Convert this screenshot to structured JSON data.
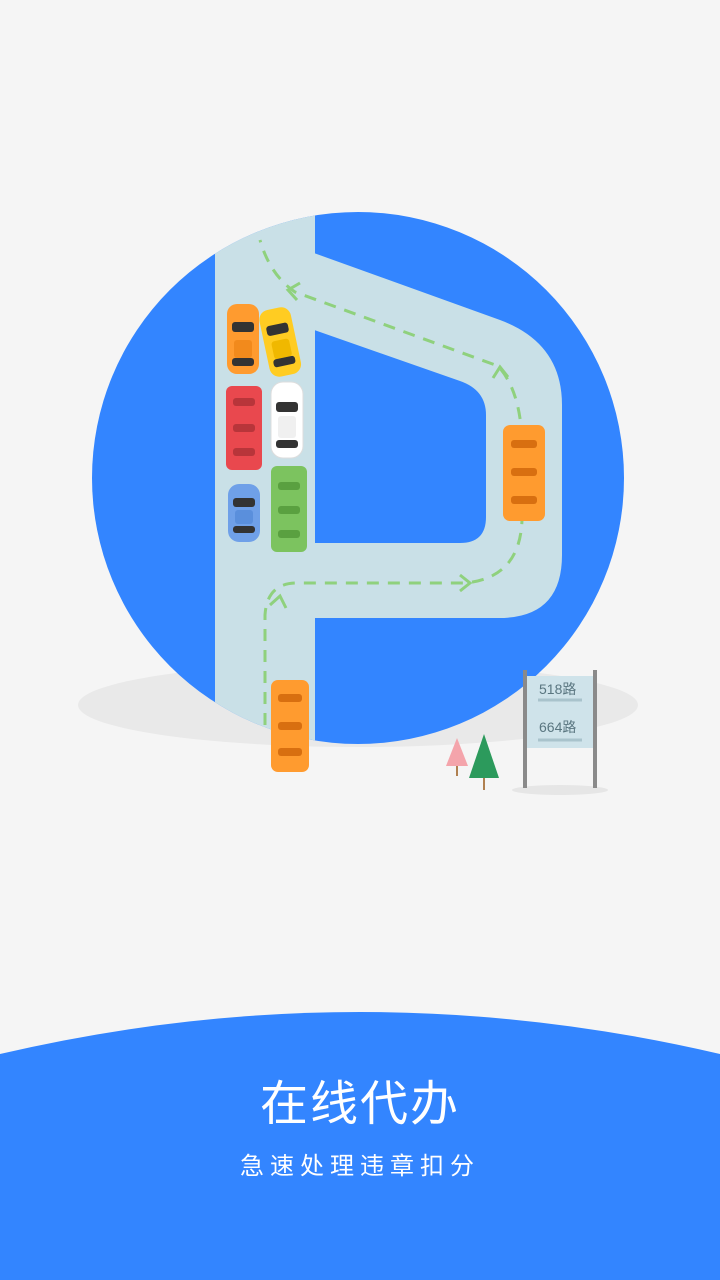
{
  "colors": {
    "brand_blue": "#3385ff",
    "road": "#c9e0e7",
    "background": "#f5f5f5",
    "route": "#8fd17d"
  },
  "signpost": {
    "route_1": "518路",
    "route_2": "664路"
  },
  "splash": {
    "title": "在线代办",
    "subtitle": "急速处理违章扣分"
  }
}
